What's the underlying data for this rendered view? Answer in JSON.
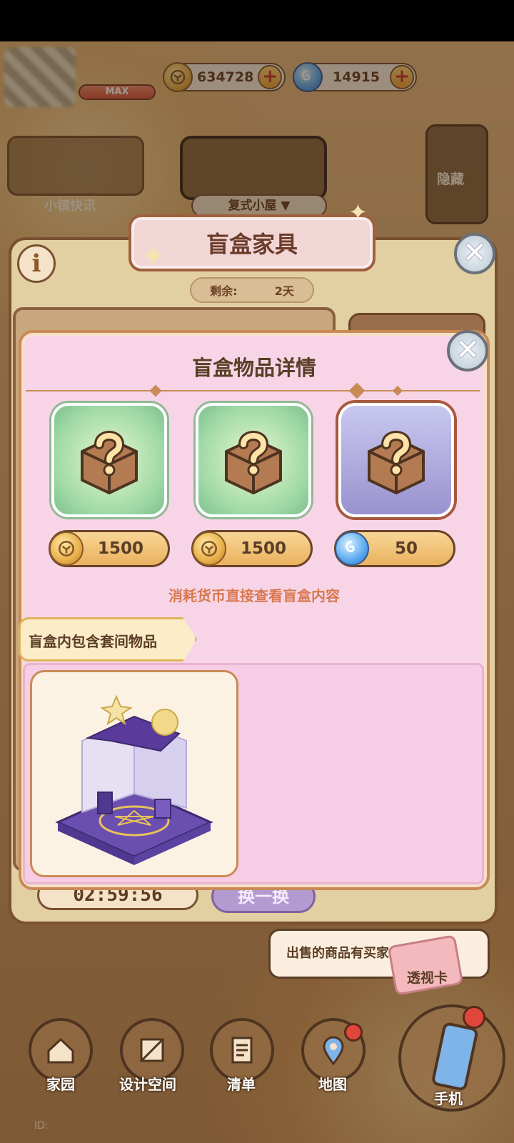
{
  "header": {
    "level_badge": "MAX",
    "currencies": [
      {
        "name": "gold-coin",
        "value": "634728",
        "color": "#e9b04b"
      },
      {
        "name": "blue-gem",
        "value": "14915",
        "color": "#5aa9f0"
      }
    ]
  },
  "background": {
    "news_label": "小镇快讯",
    "room_select": "复式小屋",
    "hide_label": "隐藏",
    "timer": "02:59:56",
    "swap_label": "换一换",
    "sale_message": "出售的商品有买家",
    "xray_card": "透视卡"
  },
  "shop_panel": {
    "title": "盲盒家具",
    "remain_label": "剩余:",
    "remain_value": "2天"
  },
  "detail_popup": {
    "title": "盲盒物品详情",
    "boxes": [
      {
        "style": "green",
        "currency_icon": "gold-coin-icon",
        "price": "1500"
      },
      {
        "style": "green",
        "currency_icon": "gold-coin-icon",
        "price": "1500"
      },
      {
        "style": "purple",
        "currency_icon": "blue-gem-icon",
        "price": "50"
      }
    ],
    "hint": "消耗货币直接查看盲盒内容",
    "contains_label": "盲盒内包含套间物品"
  },
  "bottom_nav": {
    "items": [
      {
        "label": "家园",
        "icon": "house-icon"
      },
      {
        "label": "设计空间",
        "icon": "ruler-icon"
      },
      {
        "label": "清单",
        "icon": "list-icon"
      },
      {
        "label": "地图",
        "icon": "map-pin-icon"
      },
      {
        "label": "手机",
        "icon": "phone-icon"
      }
    ]
  },
  "colors": {
    "accent_brown": "#7a5130",
    "popup_pink": "#f7d5e7",
    "hint_orange": "#d8784f"
  }
}
